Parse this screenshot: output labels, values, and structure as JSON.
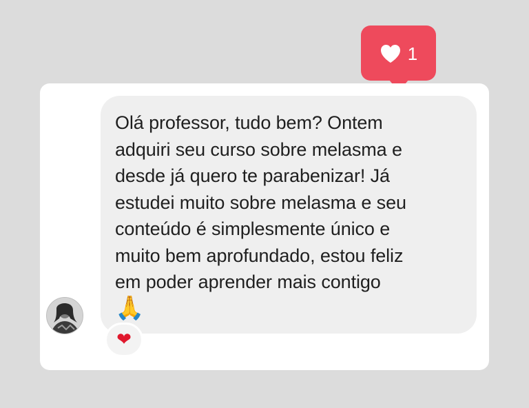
{
  "notification": {
    "icon": "heart-icon",
    "count": "1",
    "color": "#ee4a5c"
  },
  "message": {
    "text": "Olá professor, tudo bem? Ontem\nadquiri seu curso sobre melasma e\ndesde já quero te parabenizar! Já\nestudei muito sobre melasma e seu\nconteúdo é simplesmente único e\nmuito bem aprofundado, estou feliz\nem poder aprender mais contigo",
    "emoji": "🙏"
  },
  "sender": {
    "avatar": "avatar"
  },
  "reaction": {
    "emoji": "❤"
  }
}
